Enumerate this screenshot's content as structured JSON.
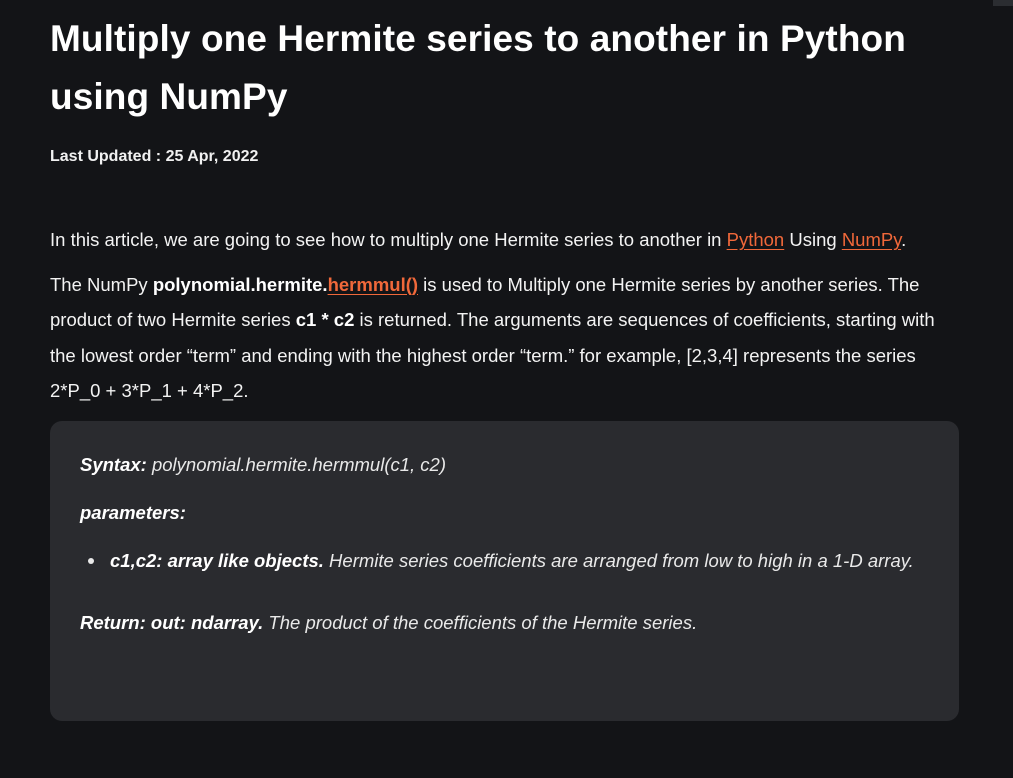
{
  "article": {
    "title": "Multiply one Hermite series to another in Python using NumPy",
    "last_updated_label": "Last Updated :",
    "last_updated_date": "25 Apr, 2022"
  },
  "intro": {
    "text_before": "In this article, we are going to see how to multiply one Hermite series to another in ",
    "link_python": "Python",
    "text_middle": " Using ",
    "link_numpy": "NumPy",
    "text_after": "."
  },
  "description": {
    "text_1": "The NumPy ",
    "bold_1": "polynomial.hermite.",
    "link_hermmul": "hermmul()",
    "text_2": " is used to Multiply one Hermite series by another series. The product of two Hermite series ",
    "bold_2": "c1 * c2",
    "text_3": " is returned. The arguments are sequences of coefficients, starting with the lowest order “term” and ending with the highest order “term.” for example, [2,3,4] represents the series 2*P_0 + 3*P_1 + 4*P_2."
  },
  "syntax_box": {
    "syntax_label": "Syntax:",
    "syntax_value": " polynomial.hermite.hermmul(c1, c2)",
    "parameters_label": "parameters:",
    "param_name": "c1,c2: array like objects.",
    "param_desc": " Hermite series coefficients are arranged from low to high in a 1-D array.",
    "return_label": "Return: out: ndarray.",
    "return_desc": " The product of the coefficients of the Hermite series."
  },
  "colors": {
    "background": "#131417",
    "link": "#f0683a",
    "box": "#2a2b2f"
  }
}
